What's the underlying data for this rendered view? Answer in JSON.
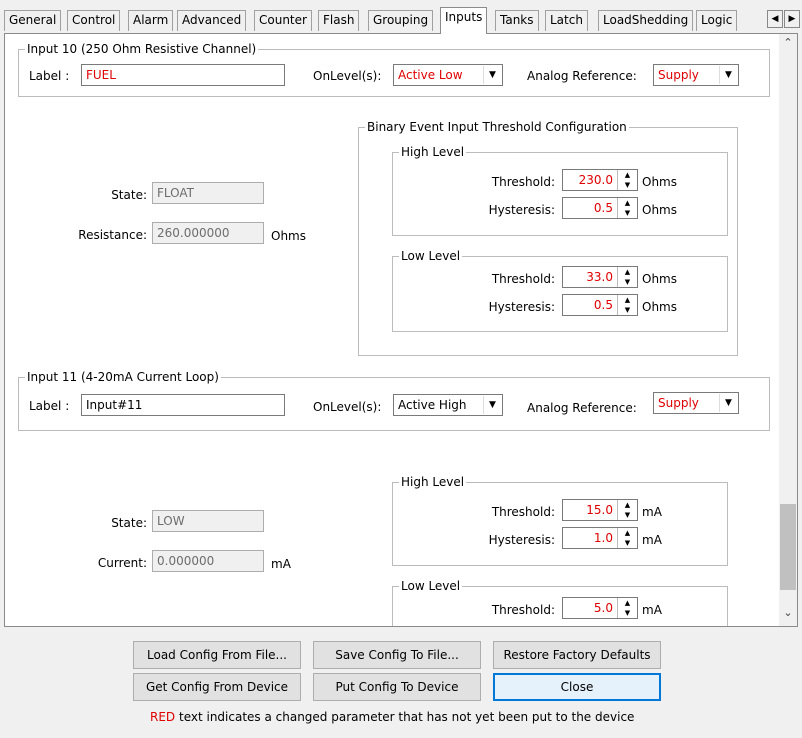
{
  "tabs": {
    "items": [
      "General",
      "Control",
      "Alarm",
      "Advanced",
      "Counter",
      "Flash",
      "Grouping",
      "Inputs",
      "Tanks",
      "Latch",
      "LoadShedding",
      "Logic"
    ],
    "active": "Inputs",
    "scroll_left": "◀",
    "scroll_right": "▶"
  },
  "input10": {
    "title": "Input 10 (250 Ohm Resistive Channel)",
    "label_caption": "Label :",
    "label_value": "FUEL",
    "onlevel_caption": "OnLevel(s):",
    "onlevel_value": "Active Low",
    "analog_caption": "Analog Reference:",
    "analog_value": "Supply",
    "state_caption": "State:",
    "state_value": "FLOAT",
    "resistance_caption": "Resistance:",
    "resistance_value": "260.000000",
    "resistance_unit": "Ohms",
    "binary_title": "Binary Event Input Threshold Configuration",
    "high": {
      "title": "High Level",
      "threshold_caption": "Threshold:",
      "threshold_value": "230.0",
      "threshold_unit": "Ohms",
      "hysteresis_caption": "Hysteresis:",
      "hysteresis_value": "0.5",
      "hysteresis_unit": "Ohms"
    },
    "low": {
      "title": "Low Level",
      "threshold_caption": "Threshold:",
      "threshold_value": "33.0",
      "threshold_unit": "Ohms",
      "hysteresis_caption": "Hysteresis:",
      "hysteresis_value": "0.5",
      "hysteresis_unit": "Ohms"
    }
  },
  "input11": {
    "title": "Input 11 (4-20mA Current Loop)",
    "label_caption": "Label :",
    "label_value": "Input#11",
    "onlevel_caption": "OnLevel(s):",
    "onlevel_value": "Active High",
    "analog_caption": "Analog Reference:",
    "analog_value": "Supply",
    "state_caption": "State:",
    "state_value": "LOW",
    "current_caption": "Current:",
    "current_value": "0.000000",
    "current_unit": "mA",
    "high": {
      "title": "High Level",
      "threshold_caption": "Threshold:",
      "threshold_value": "15.0",
      "threshold_unit": "mA",
      "hysteresis_caption": "Hysteresis:",
      "hysteresis_value": "1.0",
      "hysteresis_unit": "mA"
    },
    "low": {
      "title": "Low Level",
      "threshold_caption": "Threshold:",
      "threshold_value": "5.0",
      "threshold_unit": "mA"
    }
  },
  "buttons": {
    "load": "Load Config From File...",
    "save": "Save Config To File...",
    "restore": "Restore Factory Defaults",
    "get": "Get Config From Device",
    "put": "Put Config To Device",
    "close": "Close"
  },
  "legend": {
    "red_word": "RED",
    "rest": " text indicates a changed parameter that has not yet been put to the device"
  },
  "colors": {
    "changed": "#e00000",
    "focus": "#0078d7"
  },
  "icons": {
    "dropdown": "▼",
    "spin_up": "▲",
    "spin_down": "▼",
    "scroll_up": "⌃",
    "scroll_down": "⌄"
  }
}
